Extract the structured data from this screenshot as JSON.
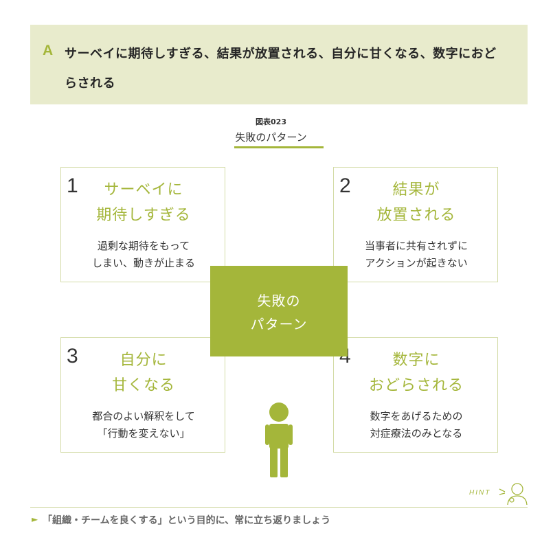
{
  "answer": {
    "mark": "A",
    "line1": "サーベイに期待しすぎる、結果が放置される、自分に甘くなる、数字におど",
    "line2": "らされる"
  },
  "figure": {
    "number": "図表023",
    "title": "失敗のパターン"
  },
  "quadrants": [
    {
      "num": "1",
      "title_l1": "サーベイに",
      "title_l2": "期待しすぎる",
      "desc_l1": "過剰な期待をもって",
      "desc_l2": "しまい、動きが止まる"
    },
    {
      "num": "2",
      "title_l1": "結果が",
      "title_l2": "放置される",
      "desc_l1": "当事者に共有されずに",
      "desc_l2": "アクションが起きない"
    },
    {
      "num": "3",
      "title_l1": "自分に",
      "title_l2": "甘くなる",
      "desc_l1": "都合のよい解釈をして",
      "desc_l2": "「行動を変えない」"
    },
    {
      "num": "4",
      "title_l1": "数字に",
      "title_l2": "おどらされる",
      "desc_l1": "数字をあげるための",
      "desc_l2": "対症療法のみとなる"
    }
  ],
  "center": {
    "line1": "失敗の",
    "line2": "パターン"
  },
  "hint": {
    "label": "HINT",
    "arrow": "►",
    "text": "「組織・チームを良くする」という目的に、常に立ち返りましょう"
  },
  "colors": {
    "accent": "#a4b63a",
    "banner_bg": "#e8ebcc"
  },
  "icons": [
    "person-icon",
    "hint-person-icon"
  ]
}
